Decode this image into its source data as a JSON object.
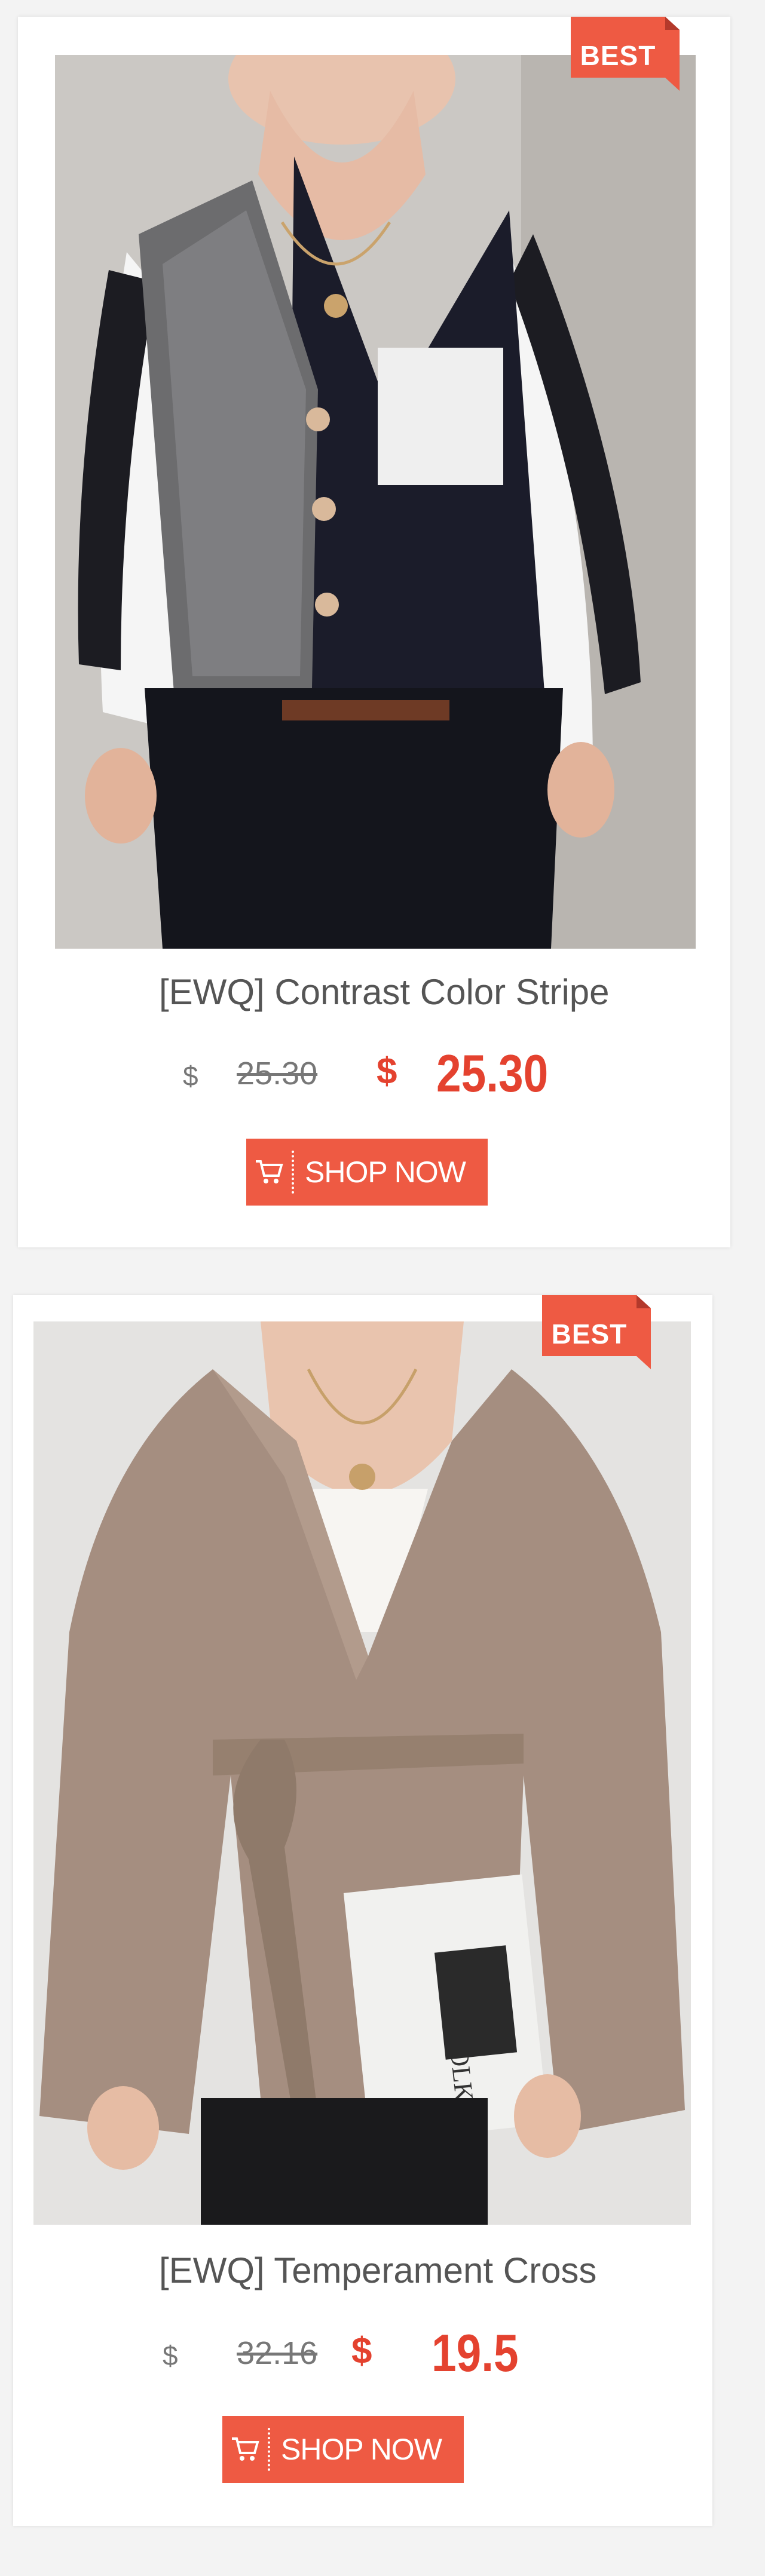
{
  "products": [
    {
      "badge": "BEST",
      "title": "[EWQ] Contrast Color Stripe",
      "currency_symbol": "$",
      "original_price": "25.30",
      "sale_currency_symbol": "$",
      "sale_price": "25.30",
      "button_label": "SHOP NOW",
      "image_icon": "cardigan-photo"
    },
    {
      "badge": "BEST",
      "title": "[EWQ] Temperament Cross",
      "currency_symbol": "$",
      "original_price": "32.16",
      "sale_currency_symbol": "$",
      "sale_price": "19.5",
      "button_label": "SHOP NOW",
      "image_icon": "wrap-cardigan-photo"
    }
  ],
  "colors": {
    "accent": "#ee5a43",
    "price_red": "#e4422f",
    "text_gray": "#555555"
  },
  "icons": {
    "cart": "shopping-cart-icon"
  }
}
